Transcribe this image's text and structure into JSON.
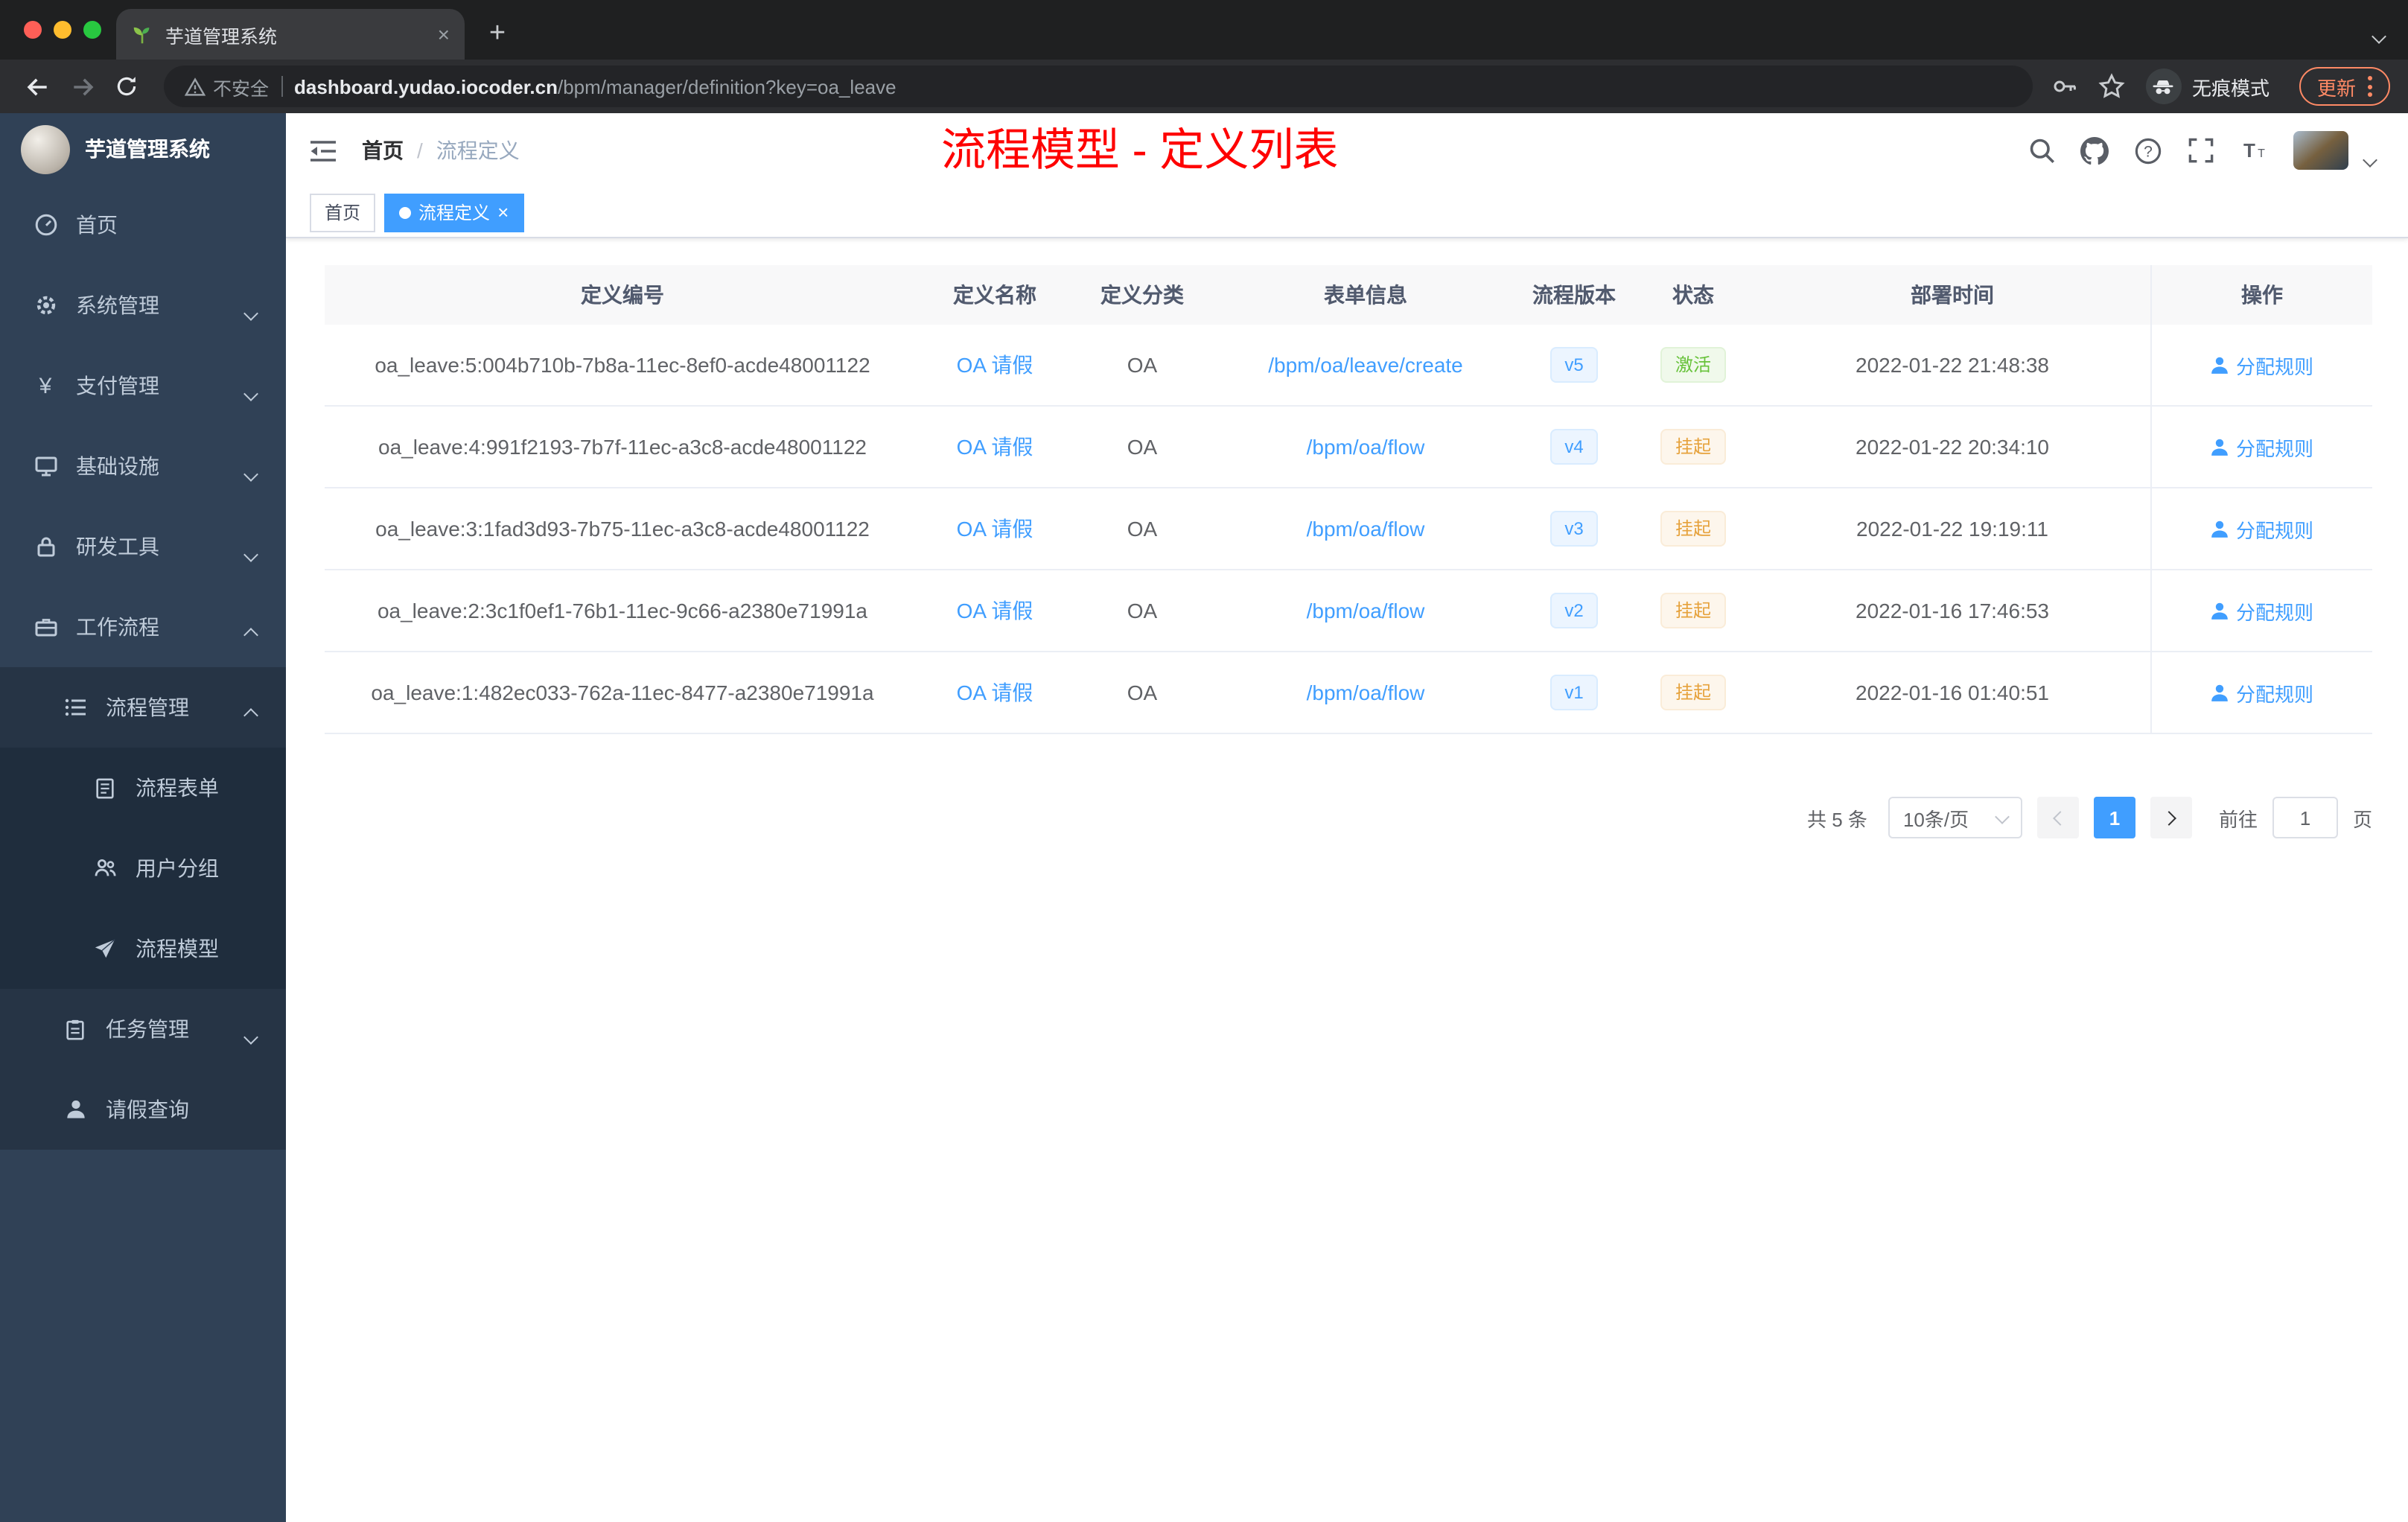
{
  "browser": {
    "tab_title": "芋道管理系统",
    "close_tab": "×",
    "new_tab_button": "+",
    "security_label": "不安全",
    "url_domain": "dashboard.yudao.iocoder.cn",
    "url_path": "/bpm/manager/definition?key=oa_leave",
    "incognito_label": "无痕模式",
    "update_label": "更新"
  },
  "sidebar": {
    "logo_title": "芋道管理系统",
    "items": [
      {
        "label": "首页"
      },
      {
        "label": "系统管理"
      },
      {
        "label": "支付管理"
      },
      {
        "label": "基础设施"
      },
      {
        "label": "研发工具"
      },
      {
        "label": "工作流程"
      },
      {
        "label": "流程管理"
      },
      {
        "label": "流程表单"
      },
      {
        "label": "用户分组"
      },
      {
        "label": "流程模型"
      },
      {
        "label": "任务管理"
      },
      {
        "label": "请假查询"
      }
    ]
  },
  "header": {
    "breadcrumb_home": "首页",
    "breadcrumb_separator": "/",
    "breadcrumb_current": "流程定义",
    "annotation": "流程模型 - 定义列表"
  },
  "tags": {
    "home": "首页",
    "active": "流程定义",
    "close": "×"
  },
  "table": {
    "columns": [
      "定义编号",
      "定义名称",
      "定义分类",
      "表单信息",
      "流程版本",
      "状态",
      "部署时间",
      "操作"
    ],
    "rows": [
      {
        "id": "oa_leave:5:004b710b-7b8a-11ec-8ef0-acde48001122",
        "name": "OA 请假",
        "category": "OA",
        "form": "/bpm/oa/leave/create",
        "version": "v5",
        "status": "激活",
        "status_type": "success",
        "deploy_time": "2022-01-22 21:48:38",
        "action": "分配规则"
      },
      {
        "id": "oa_leave:4:991f2193-7b7f-11ec-a3c8-acde48001122",
        "name": "OA 请假",
        "category": "OA",
        "form": "/bpm/oa/flow",
        "version": "v4",
        "status": "挂起",
        "status_type": "warning",
        "deploy_time": "2022-01-22 20:34:10",
        "action": "分配规则"
      },
      {
        "id": "oa_leave:3:1fad3d93-7b75-11ec-a3c8-acde48001122",
        "name": "OA 请假",
        "category": "OA",
        "form": "/bpm/oa/flow",
        "version": "v3",
        "status": "挂起",
        "status_type": "warning",
        "deploy_time": "2022-01-22 19:19:11",
        "action": "分配规则"
      },
      {
        "id": "oa_leave:2:3c1f0ef1-76b1-11ec-9c66-a2380e71991a",
        "name": "OA 请假",
        "category": "OA",
        "form": "/bpm/oa/flow",
        "version": "v2",
        "status": "挂起",
        "status_type": "warning",
        "deploy_time": "2022-01-16 17:46:53",
        "action": "分配规则"
      },
      {
        "id": "oa_leave:1:482ec033-762a-11ec-8477-a2380e71991a",
        "name": "OA 请假",
        "category": "OA",
        "form": "/bpm/oa/flow",
        "version": "v1",
        "status": "挂起",
        "status_type": "warning",
        "deploy_time": "2022-01-16 01:40:51",
        "action": "分配规则"
      }
    ]
  },
  "pagination": {
    "total": "共 5 条",
    "page_size": "10条/页",
    "current_page": "1",
    "goto": "前往",
    "goto_value": "1",
    "unit": "页"
  },
  "colors": {
    "accent_blue": "#409eff",
    "success_green": "#67c23a",
    "warning_orange": "#e6a23c",
    "annotation_red": "#fe0101",
    "sidebar_bg": "#304156"
  }
}
